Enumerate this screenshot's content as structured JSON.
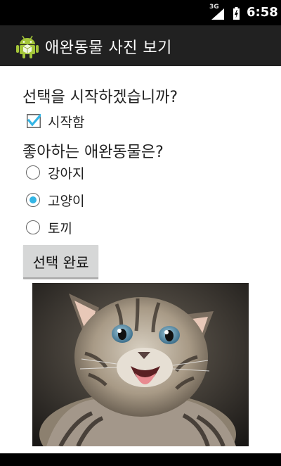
{
  "status_bar": {
    "network": "3G",
    "time": "6:58"
  },
  "app": {
    "title": "애완동물 사진 보기"
  },
  "content": {
    "question1": "선택을 시작하겠습니까?",
    "start_checkbox": {
      "label": "시작함",
      "checked": true
    },
    "question2": "좋아하는 애완동물은?",
    "pets": [
      {
        "label": "강아지",
        "selected": false
      },
      {
        "label": "고양이",
        "selected": true
      },
      {
        "label": "토끼",
        "selected": false
      }
    ],
    "done_button": "선택 완료",
    "image": {
      "subject": "kitten-photo"
    }
  },
  "colors": {
    "accent": "#33b5e5",
    "action_bar": "#212121",
    "button": "#d6d7d7"
  }
}
